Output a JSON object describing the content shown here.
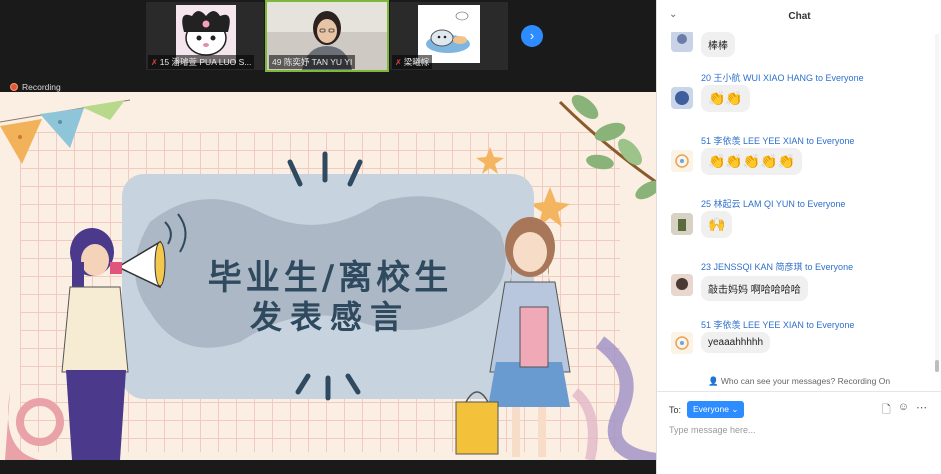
{
  "thumbnails": [
    {
      "label": "15 潘璿萱 PUA LUO S...",
      "muted": true,
      "active": false
    },
    {
      "label": "49 陈奕妤 TAN YU YI",
      "muted": false,
      "active": true
    },
    {
      "label": "梁曦幏",
      "muted": true,
      "active": false
    }
  ],
  "next_icon": "chevron-right",
  "recording_label": "Recording",
  "slide": {
    "title_line1": "毕业生/离校生",
    "title_line2": "发表感言"
  },
  "chat": {
    "title": "Chat",
    "messages": [
      {
        "sender": "",
        "to": "",
        "text": "棒棒"
      },
      {
        "sender": "20 王小航 WUI XIAO HANG",
        "to": "to Everyone",
        "text": "👏👏"
      },
      {
        "sender": "51 李依羡 LEE YEE XIAN",
        "to": "to Everyone",
        "text": "👏👏👏👏👏"
      },
      {
        "sender": "25 林起云 LAM QI YUN",
        "to": "to Everyone",
        "text": "🙌"
      },
      {
        "sender": "23 JENSSQI KAN 简彦琪",
        "to": "to Everyone",
        "text": "敲击妈妈 啊哈哈哈哈"
      },
      {
        "sender": "51 李依羡 LEE YEE XIAN",
        "to": "to Everyone",
        "text": "yeaaahhhhh"
      }
    ],
    "privacy_note": "Who can see your messages? Recording On",
    "to_label": "To:",
    "recipient": "Everyone",
    "input_placeholder": "Type message here..."
  },
  "colors": {
    "accent": "#2d8cff",
    "sender": "#2d6fcc",
    "slide_bg": "#fbeee2",
    "title": "#2f4a5e"
  }
}
